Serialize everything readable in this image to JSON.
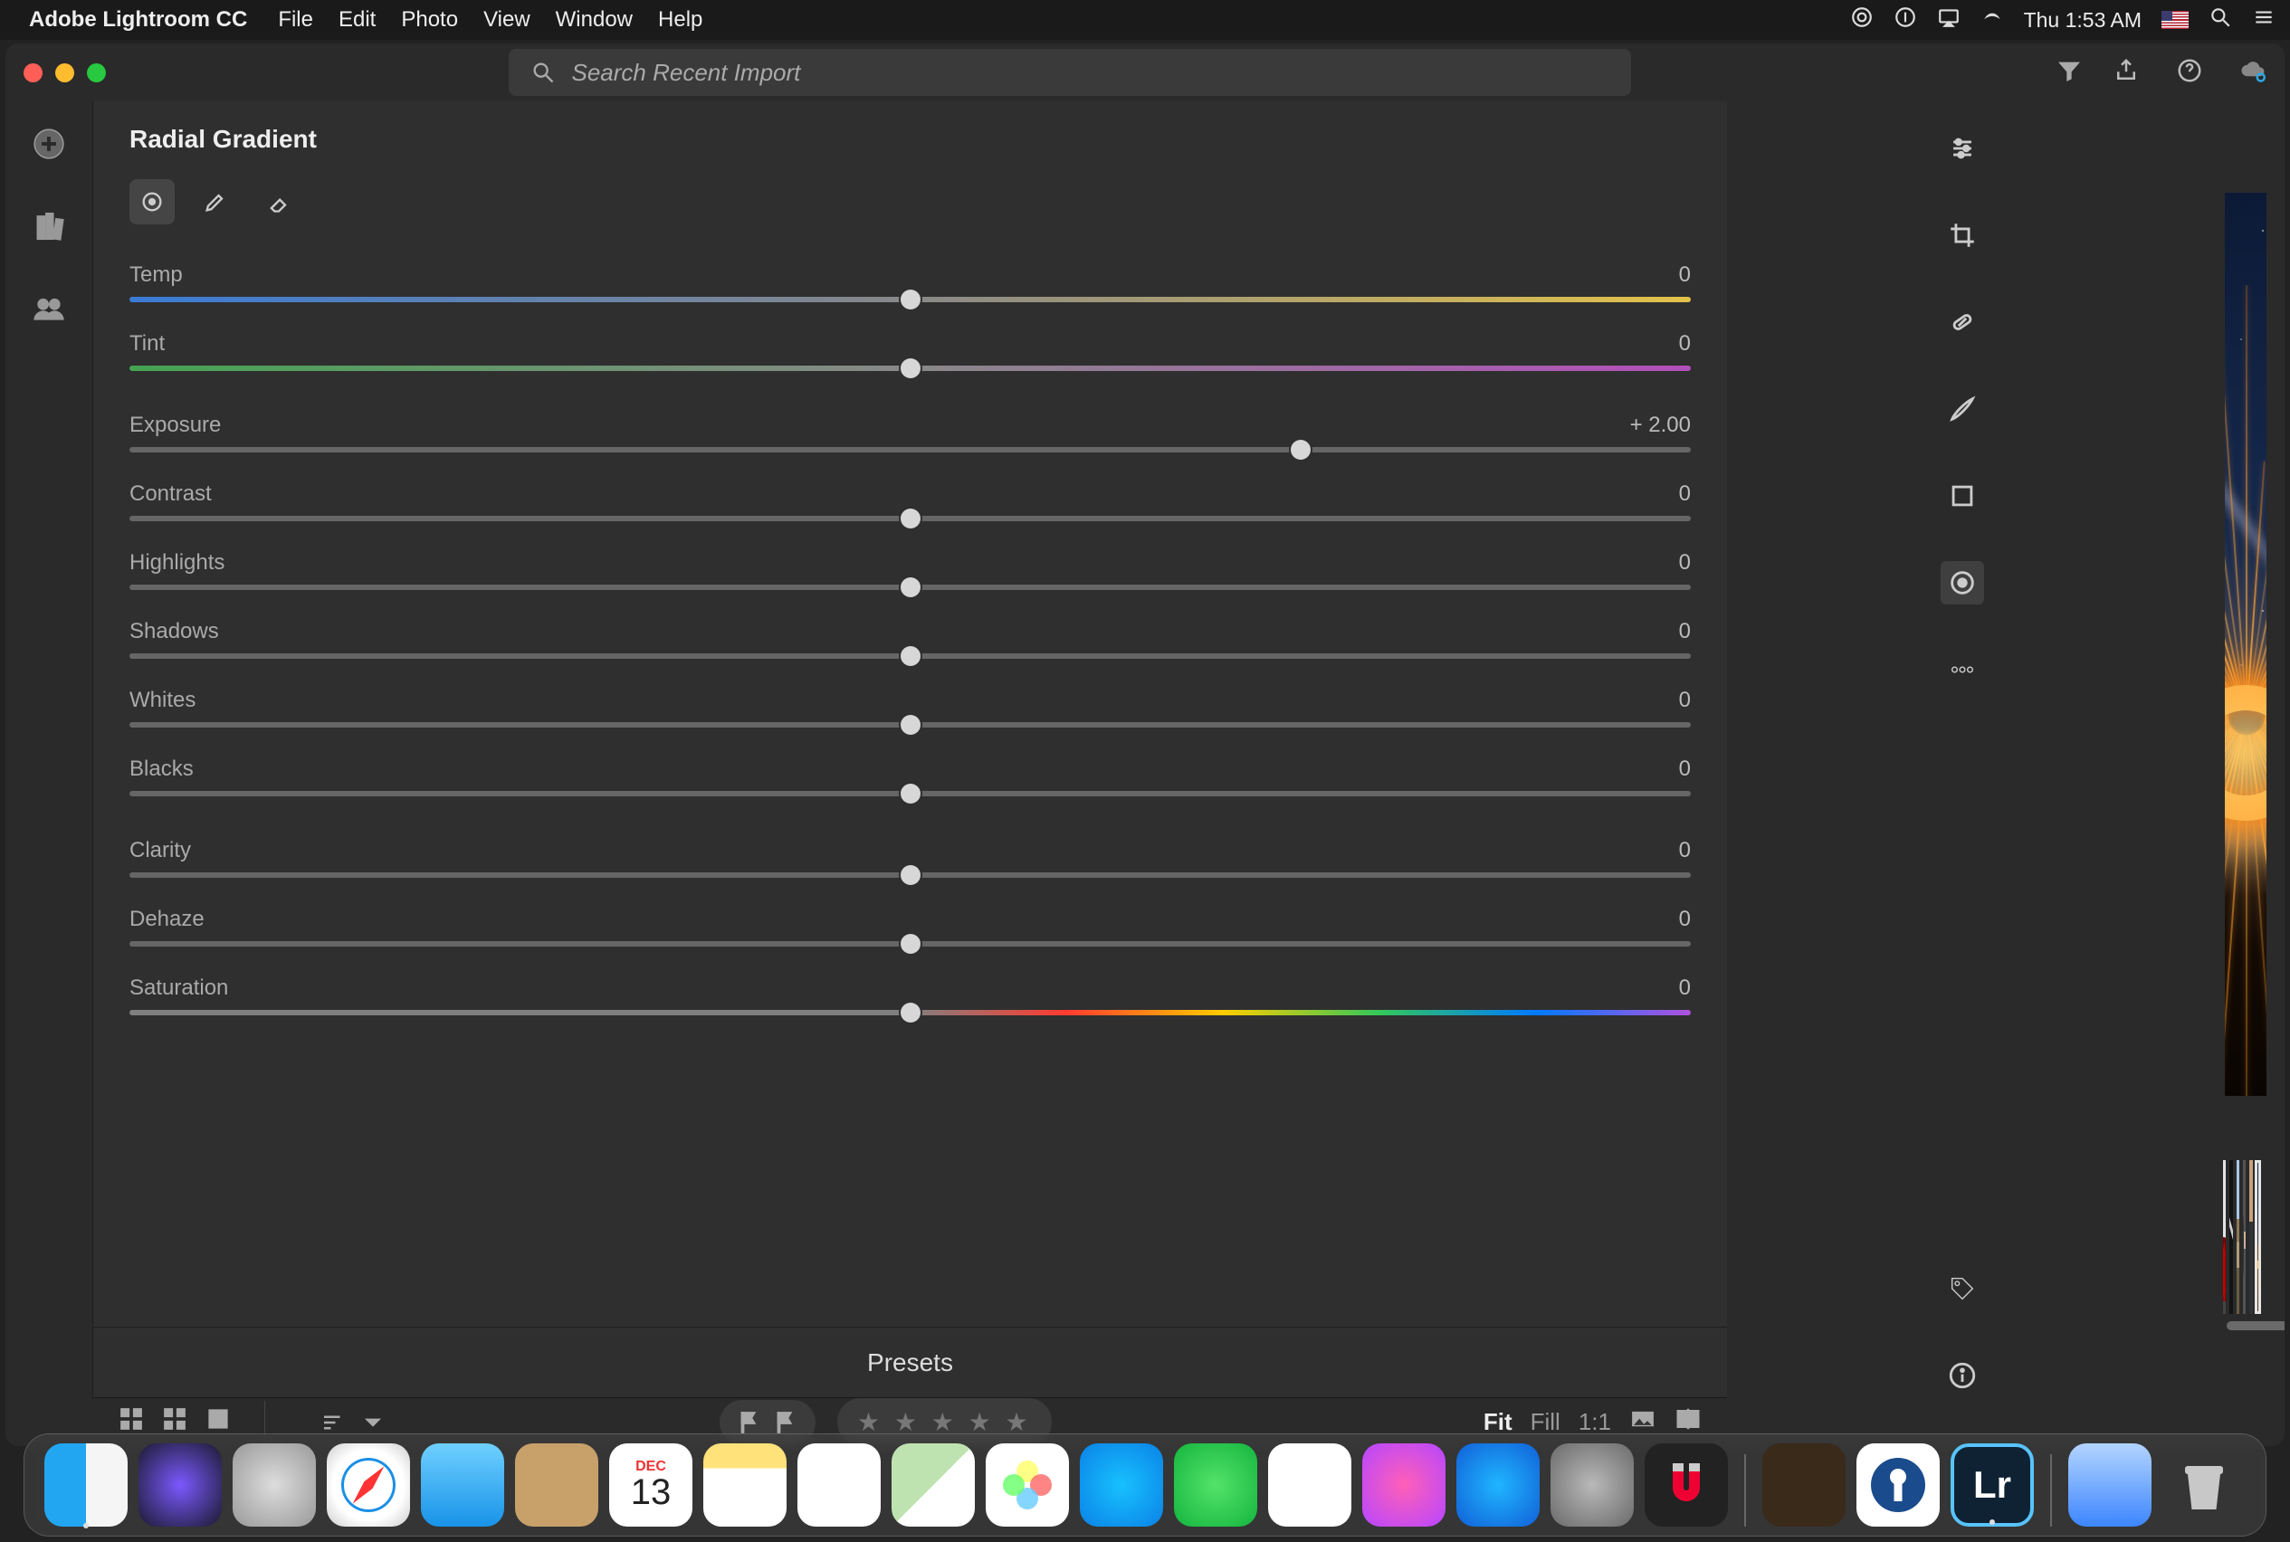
{
  "menubar": {
    "app_name": "Adobe Lightroom CC",
    "menus": [
      "File",
      "Edit",
      "Photo",
      "View",
      "Window",
      "Help"
    ],
    "clock": "Thu 1:53 AM"
  },
  "titlebar": {
    "search_placeholder": "Search Recent Import"
  },
  "panel": {
    "title": "Radial Gradient",
    "sliders": [
      {
        "key": "temp",
        "label": "Temp",
        "value": "0",
        "pos": 50,
        "track": "track-temp"
      },
      {
        "key": "tint",
        "label": "Tint",
        "value": "0",
        "pos": 50,
        "track": "track-tint"
      },
      {
        "key": "exposure",
        "label": "Exposure",
        "value": "+ 2.00",
        "pos": 75,
        "track": "track-grey"
      },
      {
        "key": "contrast",
        "label": "Contrast",
        "value": "0",
        "pos": 50,
        "track": "track-grey"
      },
      {
        "key": "highlights",
        "label": "Highlights",
        "value": "0",
        "pos": 50,
        "track": "track-grey"
      },
      {
        "key": "shadows",
        "label": "Shadows",
        "value": "0",
        "pos": 50,
        "track": "track-grey"
      },
      {
        "key": "whites",
        "label": "Whites",
        "value": "0",
        "pos": 50,
        "track": "track-grey"
      },
      {
        "key": "blacks",
        "label": "Blacks",
        "value": "0",
        "pos": 50,
        "track": "track-grey"
      },
      {
        "key": "clarity",
        "label": "Clarity",
        "value": "0",
        "pos": 50,
        "track": "track-grey"
      },
      {
        "key": "dehaze",
        "label": "Dehaze",
        "value": "0",
        "pos": 50,
        "track": "track-grey"
      },
      {
        "key": "saturation",
        "label": "Saturation",
        "value": "0",
        "pos": 50,
        "track": "track-sat"
      }
    ],
    "presets_label": "Presets"
  },
  "footer": {
    "zoom": {
      "fit": "Fit",
      "fill": "Fill",
      "one": "1:1"
    },
    "stars": "★ ★ ★ ★ ★"
  },
  "thumbs": [
    {
      "name": "thumb-car",
      "cls": "car"
    },
    {
      "name": "thumb-apple",
      "cls": "apple"
    },
    {
      "name": "thumb-mountain",
      "cls": "mount"
    },
    {
      "name": "thumb-coffee",
      "cls": "coffee"
    },
    {
      "name": "thumb-waves",
      "cls": "waves"
    },
    {
      "name": "thumb-fire",
      "cls": "fire",
      "selected": true
    }
  ],
  "dock": [
    "finder",
    "siri",
    "launch",
    "safari",
    "mail",
    "contacts",
    "cal",
    "notes",
    "rem",
    "maps",
    "photos",
    "mess",
    "ft",
    "news",
    "itunes",
    "appstore",
    "pref",
    "magnet",
    "|",
    "imovie",
    "1pw",
    "lr",
    "|",
    "dl",
    "trash"
  ],
  "dock_active": [
    "finder",
    "lr"
  ]
}
